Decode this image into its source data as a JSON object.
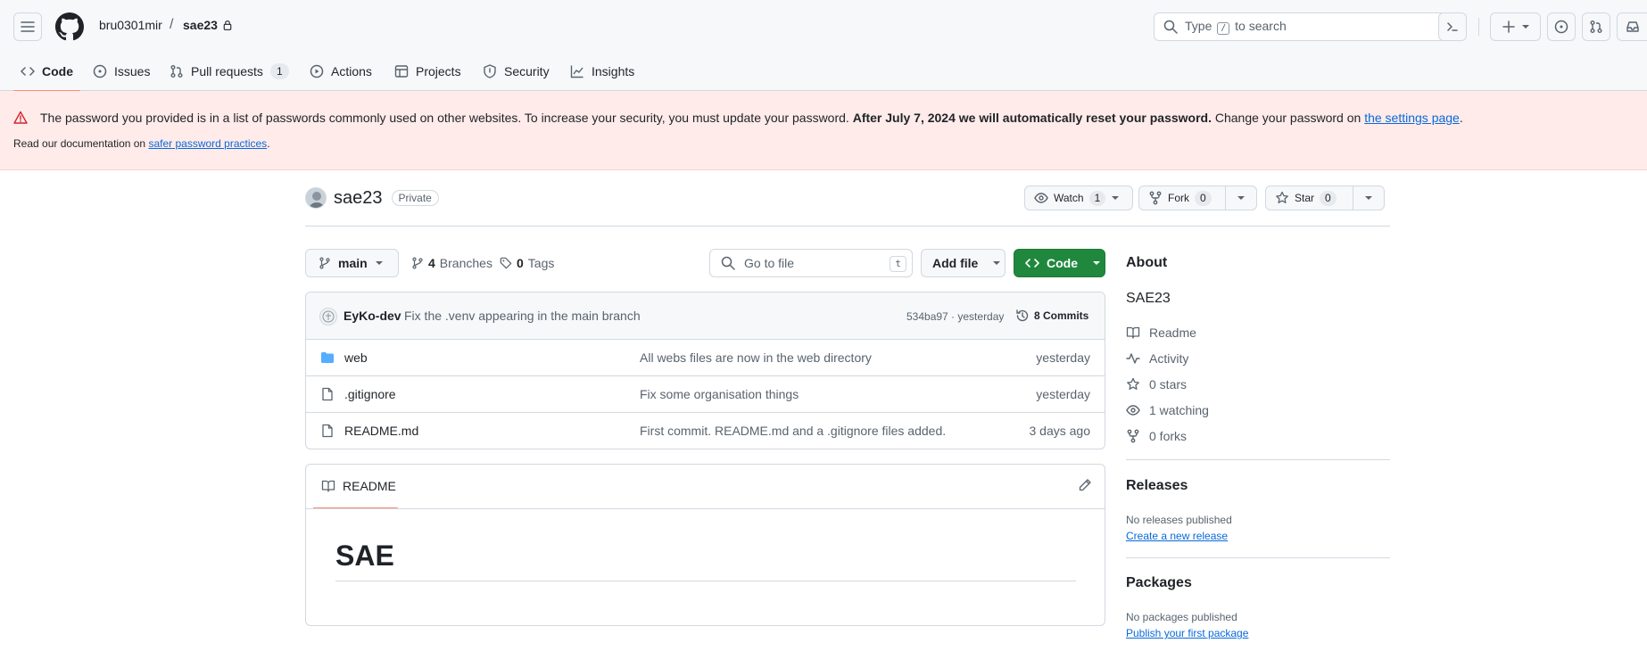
{
  "header": {
    "owner": "bru0301mir",
    "separator": "/",
    "repo": "sae23",
    "search_prefix": "Type",
    "search_key": "/",
    "search_suffix": "to search"
  },
  "tabs": [
    {
      "label": "Code"
    },
    {
      "label": "Issues"
    },
    {
      "label": "Pull requests",
      "count": "1"
    },
    {
      "label": "Actions"
    },
    {
      "label": "Projects"
    },
    {
      "label": "Security"
    },
    {
      "label": "Insights"
    }
  ],
  "banner": {
    "text1": "The password you provided is in a list of passwords commonly used on other websites. To increase your security, you must update your password.",
    "bold": "After July 7, 2024 we will automatically reset your password.",
    "text2": "Change your password on",
    "link1": "the settings page",
    "end1": ".",
    "line2_prefix": "Read our documentation on",
    "link2": "safer password practices",
    "end2": "."
  },
  "repo": {
    "name": "sae23",
    "visibility": "Private",
    "watch_label": "Watch",
    "watch_count": "1",
    "fork_label": "Fork",
    "fork_count": "0",
    "star_label": "Star",
    "star_count": "0"
  },
  "toolbar": {
    "branch": "main",
    "branches_count": "4",
    "branches_label": "Branches",
    "tags_count": "0",
    "tags_label": "Tags",
    "goto_placeholder": "Go to file",
    "goto_key": "t",
    "add_file": "Add file",
    "code": "Code"
  },
  "latest_commit": {
    "author": "EyKo-dev",
    "message": "Fix the .venv appearing in the main branch",
    "hash_time": "534ba97 · yesterday",
    "commits": "8 Commits"
  },
  "files": [
    {
      "name": "web",
      "type": "folder",
      "message": "All webs files are now in the web directory",
      "time": "yesterday"
    },
    {
      "name": ".gitignore",
      "type": "file",
      "message": "Fix some organisation things",
      "time": "yesterday"
    },
    {
      "name": "README.md",
      "type": "file",
      "message": "First commit. README.md and a .gitignore files added.",
      "time": "3 days ago"
    }
  ],
  "readme": {
    "tab": "README",
    "heading": "SAE"
  },
  "sidebar": {
    "about_title": "About",
    "description": "SAE23",
    "items": [
      {
        "label": "Readme",
        "icon": "book-icon"
      },
      {
        "label": "Activity",
        "icon": "pulse-icon"
      },
      {
        "label": "0 stars",
        "icon": "star-icon"
      },
      {
        "label": "1 watching",
        "icon": "eye-icon"
      },
      {
        "label": "0 forks",
        "icon": "fork-icon"
      }
    ],
    "releases_title": "Releases",
    "releases_text": "No releases published",
    "releases_link": "Create a new release",
    "packages_title": "Packages",
    "packages_text": "No packages published",
    "packages_link": "Publish your first package"
  },
  "colors": {
    "accent_green": "#1f883d",
    "tab_underline": "#fd8c73",
    "banner_bg": "#ffebe9",
    "link": "#0969da",
    "folder": "#54aeff"
  }
}
